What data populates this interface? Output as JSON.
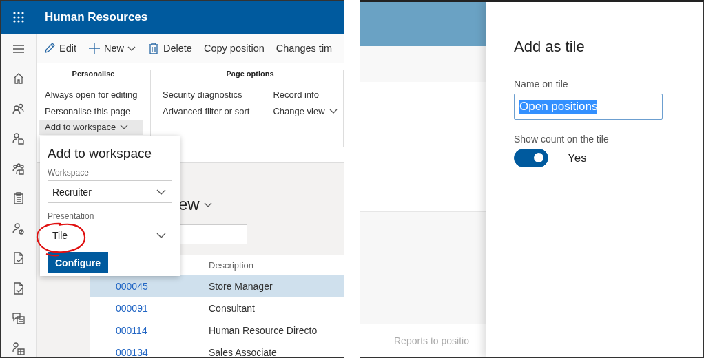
{
  "left_screen": {
    "app_bar": {
      "title": "Human Resources"
    },
    "toolbar": [
      {
        "kind": "edit",
        "label": "Edit"
      },
      {
        "kind": "new",
        "label": "New",
        "has_menu": true
      },
      {
        "kind": "delete",
        "label": "Delete"
      },
      {
        "kind": "plain",
        "label": "Copy position"
      },
      {
        "kind": "plain",
        "label": "Changes tim"
      }
    ],
    "ribbon": [
      {
        "title": "Personalise",
        "columns": [
          [
            {
              "label": "Always open for editing",
              "has_menu": false,
              "selected": false
            },
            {
              "label": "Personalise this page",
              "has_menu": false,
              "selected": false
            },
            {
              "label": "Add to workspace",
              "has_menu": true,
              "selected": true
            }
          ]
        ]
      },
      {
        "title": "Page options",
        "columns": [
          [
            {
              "label": "Security diagnostics",
              "has_menu": false,
              "selected": false
            },
            {
              "label": "Advanced filter or sort",
              "has_menu": false,
              "selected": false
            }
          ],
          [
            {
              "label": "Record info",
              "has_menu": false,
              "selected": false
            },
            {
              "label": "Change view",
              "has_menu": true,
              "selected": false
            }
          ]
        ]
      }
    ],
    "page": {
      "title": "ew",
      "description_header": "Description",
      "rows": [
        {
          "id": "000045",
          "description": "Store Manager",
          "selected": true
        },
        {
          "id": "000091",
          "description": "Consultant",
          "selected": false
        },
        {
          "id": "000114",
          "description": "Human Resource Directo",
          "selected": false
        },
        {
          "id": "000134",
          "description": "Sales Associate",
          "selected": false
        }
      ]
    },
    "flyout": {
      "title": "Add to workspace",
      "fields": [
        {
          "label": "Workspace",
          "value": "Recruiter",
          "circled": false
        },
        {
          "label": "Presentation",
          "value": "Tile",
          "circled": true
        }
      ],
      "button": "Configure"
    }
  },
  "right_screen": {
    "background_label": "Reports to positio",
    "dialog": {
      "title": "Add as tile",
      "name_label": "Name on tile",
      "name_value": "Open positions",
      "name_selected": true,
      "count_label": "Show count on the tile",
      "count_on": true,
      "count_text": "Yes"
    }
  }
}
